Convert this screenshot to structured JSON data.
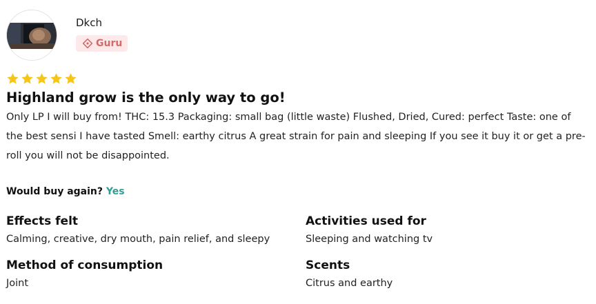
{
  "reviewer": {
    "name": "Dkch",
    "badge": "Guru",
    "badge_color": "#d46a6a",
    "badge_bg": "#fde9e9"
  },
  "rating": {
    "stars": 5,
    "max": 5,
    "star_color": "#f5c518"
  },
  "review": {
    "title": "Highland grow is the only way to go!",
    "body": "Only LP I will buy from! THC: 15.3 Packaging: small bag (little waste) Flushed, Dried, Cured: perfect Taste: one of the best sensi I have tasted Smell: earthy citrus A great strain for pain and sleeping If you see it buy it or get a pre-roll you will not be disappointed."
  },
  "would_buy_again": {
    "label": "Would buy again?",
    "value": "Yes",
    "value_color": "#2fa096"
  },
  "details": {
    "effects": {
      "title": "Effects felt",
      "value": "Calming, creative, dry mouth, pain relief, and sleepy"
    },
    "activities": {
      "title": "Activities used for",
      "value": "Sleeping and watching tv"
    },
    "method": {
      "title": "Method of consumption",
      "value": "Joint"
    },
    "scents": {
      "title": "Scents",
      "value": "Citrus and earthy"
    }
  }
}
